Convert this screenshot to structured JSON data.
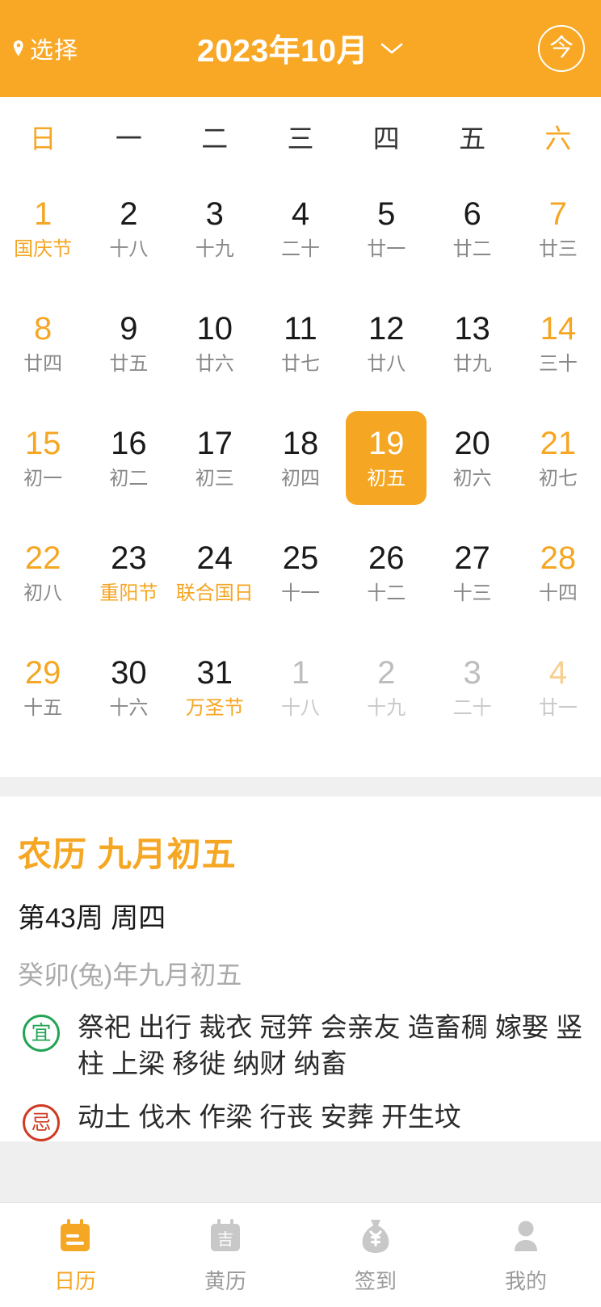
{
  "header": {
    "select_label": "选择",
    "title": "2023年10月",
    "today_label": "今",
    "pin_icon": "location-pin-icon",
    "chevron_icon": "chevron-down-icon",
    "bg_color": "#F9A825"
  },
  "calendar": {
    "weekdays": [
      "日",
      "一",
      "二",
      "三",
      "四",
      "五",
      "六"
    ],
    "accent_color": "#F5A623",
    "selected_day": "19",
    "days": [
      {
        "num": "1",
        "sub": "国庆节",
        "weekend": true,
        "festival": true,
        "out": false,
        "selected": false
      },
      {
        "num": "2",
        "sub": "十八",
        "weekend": false,
        "festival": false,
        "out": false,
        "selected": false
      },
      {
        "num": "3",
        "sub": "十九",
        "weekend": false,
        "festival": false,
        "out": false,
        "selected": false
      },
      {
        "num": "4",
        "sub": "二十",
        "weekend": false,
        "festival": false,
        "out": false,
        "selected": false
      },
      {
        "num": "5",
        "sub": "廿一",
        "weekend": false,
        "festival": false,
        "out": false,
        "selected": false
      },
      {
        "num": "6",
        "sub": "廿二",
        "weekend": false,
        "festival": false,
        "out": false,
        "selected": false
      },
      {
        "num": "7",
        "sub": "廿三",
        "weekend": true,
        "festival": false,
        "out": false,
        "selected": false
      },
      {
        "num": "8",
        "sub": "廿四",
        "weekend": true,
        "festival": false,
        "out": false,
        "selected": false
      },
      {
        "num": "9",
        "sub": "廿五",
        "weekend": false,
        "festival": false,
        "out": false,
        "selected": false
      },
      {
        "num": "10",
        "sub": "廿六",
        "weekend": false,
        "festival": false,
        "out": false,
        "selected": false
      },
      {
        "num": "11",
        "sub": "廿七",
        "weekend": false,
        "festival": false,
        "out": false,
        "selected": false
      },
      {
        "num": "12",
        "sub": "廿八",
        "weekend": false,
        "festival": false,
        "out": false,
        "selected": false
      },
      {
        "num": "13",
        "sub": "廿九",
        "weekend": false,
        "festival": false,
        "out": false,
        "selected": false
      },
      {
        "num": "14",
        "sub": "三十",
        "weekend": true,
        "festival": false,
        "out": false,
        "selected": false
      },
      {
        "num": "15",
        "sub": "初一",
        "weekend": true,
        "festival": false,
        "out": false,
        "selected": false
      },
      {
        "num": "16",
        "sub": "初二",
        "weekend": false,
        "festival": false,
        "out": false,
        "selected": false
      },
      {
        "num": "17",
        "sub": "初三",
        "weekend": false,
        "festival": false,
        "out": false,
        "selected": false
      },
      {
        "num": "18",
        "sub": "初四",
        "weekend": false,
        "festival": false,
        "out": false,
        "selected": false
      },
      {
        "num": "19",
        "sub": "初五",
        "weekend": false,
        "festival": false,
        "out": false,
        "selected": true
      },
      {
        "num": "20",
        "sub": "初六",
        "weekend": false,
        "festival": false,
        "out": false,
        "selected": false
      },
      {
        "num": "21",
        "sub": "初七",
        "weekend": true,
        "festival": false,
        "out": false,
        "selected": false
      },
      {
        "num": "22",
        "sub": "初八",
        "weekend": true,
        "festival": false,
        "out": false,
        "selected": false
      },
      {
        "num": "23",
        "sub": "重阳节",
        "weekend": false,
        "festival": true,
        "out": false,
        "selected": false
      },
      {
        "num": "24",
        "sub": "联合国日",
        "weekend": false,
        "festival": true,
        "out": false,
        "selected": false
      },
      {
        "num": "25",
        "sub": "十一",
        "weekend": false,
        "festival": false,
        "out": false,
        "selected": false
      },
      {
        "num": "26",
        "sub": "十二",
        "weekend": false,
        "festival": false,
        "out": false,
        "selected": false
      },
      {
        "num": "27",
        "sub": "十三",
        "weekend": false,
        "festival": false,
        "out": false,
        "selected": false
      },
      {
        "num": "28",
        "sub": "十四",
        "weekend": true,
        "festival": false,
        "out": false,
        "selected": false
      },
      {
        "num": "29",
        "sub": "十五",
        "weekend": true,
        "festival": false,
        "out": false,
        "selected": false
      },
      {
        "num": "30",
        "sub": "十六",
        "weekend": false,
        "festival": false,
        "out": false,
        "selected": false
      },
      {
        "num": "31",
        "sub": "万圣节",
        "weekend": false,
        "festival": true,
        "out": false,
        "selected": false
      },
      {
        "num": "1",
        "sub": "十八",
        "weekend": false,
        "festival": false,
        "out": true,
        "selected": false
      },
      {
        "num": "2",
        "sub": "十九",
        "weekend": false,
        "festival": false,
        "out": true,
        "selected": false
      },
      {
        "num": "3",
        "sub": "二十",
        "weekend": false,
        "festival": false,
        "out": true,
        "selected": false
      },
      {
        "num": "4",
        "sub": "廿一",
        "weekend": true,
        "festival": false,
        "out": true,
        "selected": false
      }
    ]
  },
  "detail": {
    "lunar_title": "农历 九月初五",
    "week_line": "第43周 周四",
    "ganzhi": "癸卯(兔)年九月初五",
    "yi": {
      "badge": "宜",
      "badge_color": "#23a455",
      "text": "祭祀 出行 裁衣 冠笄 会亲友 造畜稠 嫁娶 竖柱 上梁 移徙 纳财 纳畜"
    },
    "ji": {
      "badge": "忌",
      "badge_color": "#cf3a21",
      "text": "动土 伐木 作梁 行丧 安葬 开生坟"
    }
  },
  "tabbar": {
    "items": [
      {
        "label": "日历",
        "icon": "calendar-icon",
        "active": true
      },
      {
        "label": "黄历",
        "icon": "almanac-calendar-icon",
        "active": false
      },
      {
        "label": "签到",
        "icon": "money-bag-icon",
        "active": false
      },
      {
        "label": "我的",
        "icon": "person-icon",
        "active": false
      }
    ],
    "active_color": "#F5A623",
    "inactive_color": "#c8c8c8"
  }
}
